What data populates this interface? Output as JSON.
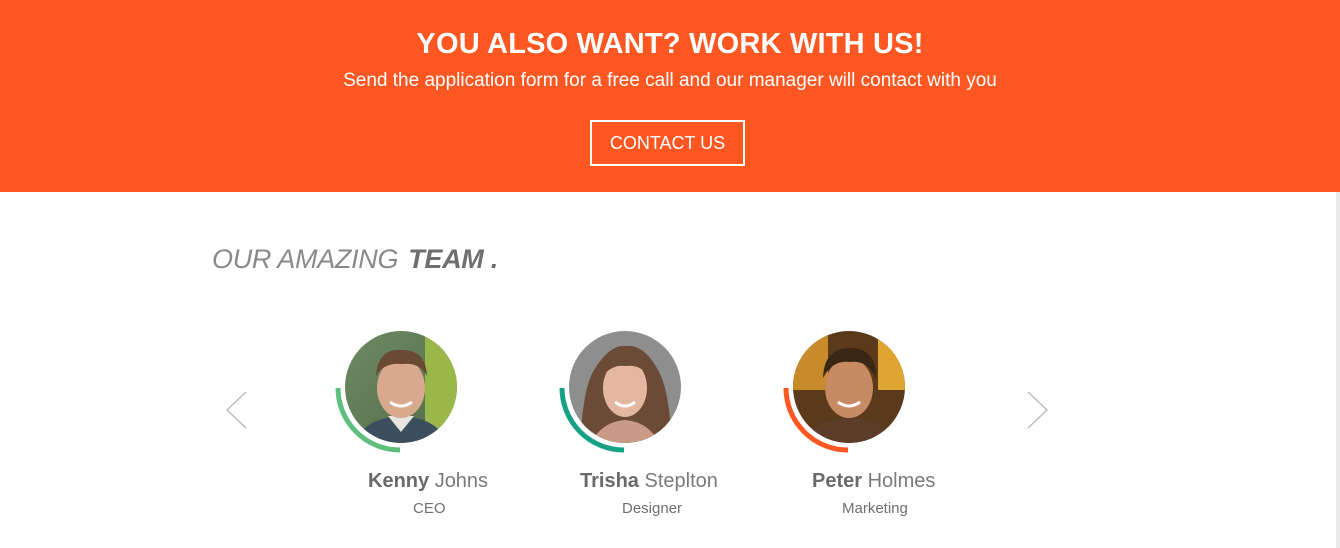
{
  "banner": {
    "title": "YOU ALSO WANT? WORK WITH US!",
    "subtitle": "Send the application form for a free call and our manager will contact with you",
    "button_label": "CONTACT US",
    "background_color": "#ff5722"
  },
  "team": {
    "heading_light": "OUR AMAZING",
    "heading_bold": "TEAM .",
    "prev_icon": "chevron-left-icon",
    "next_icon": "chevron-right-icon",
    "members": [
      {
        "first_name": "Kenny",
        "last_name": "Johns",
        "role": "CEO",
        "accent_color": "#5fbf7f"
      },
      {
        "first_name": "Trisha",
        "last_name": "Steplton",
        "role": "Designer",
        "accent_color": "#16a085"
      },
      {
        "first_name": "Peter",
        "last_name": "Holmes",
        "role": "Marketing",
        "accent_color": "#ff5722"
      }
    ]
  }
}
